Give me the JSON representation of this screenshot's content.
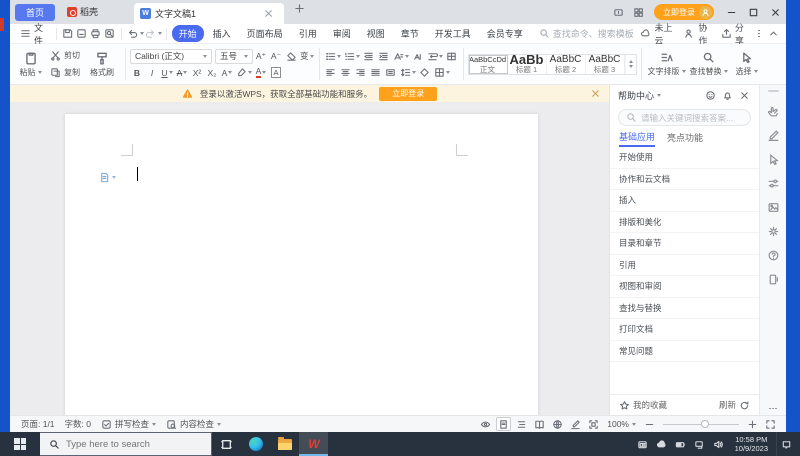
{
  "tabbar": {
    "home": "首页",
    "docer": "稻壳",
    "document": "文字文稿1",
    "login": "立即登录"
  },
  "menubar": {
    "file": "文件",
    "tabs": [
      "开始",
      "插入",
      "页面布局",
      "引用",
      "审阅",
      "视图",
      "章节",
      "开发工具",
      "会员专享"
    ],
    "search_placeholder": "查找命令、搜索模板",
    "cloud": "未上云",
    "collab": "协作",
    "share": "分享"
  },
  "ribbon": {
    "paste": "粘贴",
    "cut": "剪切",
    "copy": "复制",
    "format_painter": "格式刷",
    "font_name": "Calibri (正文)",
    "font_size": "五号",
    "glyphs": {
      "grow": "A⁺",
      "shrink": "A⁻",
      "effects": "变",
      "bold": "B",
      "italic": "I",
      "underline": "U",
      "strike": "A",
      "sup": "X²",
      "sub": "X₂",
      "pinyin": "A",
      "highlight": "A",
      "font_color": "A",
      "char_border": "A"
    },
    "styles": [
      {
        "preview": "AaBbCcDd",
        "name": "正文"
      },
      {
        "preview": "AaBb",
        "name": "标题 1"
      },
      {
        "preview": "AaBbC",
        "name": "标题 2"
      },
      {
        "preview": "AaBbC",
        "name": "标题 3"
      }
    ],
    "text_layout": "文字排版",
    "find_replace": "查找替换",
    "select": "选择"
  },
  "notification": {
    "text": "登录以激活WPS，获取全部基础功能和服务。",
    "button": "立即登录"
  },
  "help_panel": {
    "title": "帮助中心",
    "search_placeholder": "请输入关键词搜索答案...",
    "tabs": [
      "基础应用",
      "亮点功能"
    ],
    "items": [
      "开始使用",
      "协作和云文档",
      "插入",
      "排版和美化",
      "目录和章节",
      "引用",
      "视图和审阅",
      "查找与替换",
      "打印文档",
      "常见问题"
    ],
    "favorites": "我的收藏",
    "refresh": "刷新"
  },
  "statusbar": {
    "page": "页面: 1/1",
    "words": "字数: 0",
    "spell_check": "拼写检查",
    "content_check": "内容检查",
    "zoom_level": "100%"
  },
  "taskbar": {
    "search_placeholder": "Type here to search",
    "time": "10:58 PM",
    "date": "10/9/2023"
  }
}
